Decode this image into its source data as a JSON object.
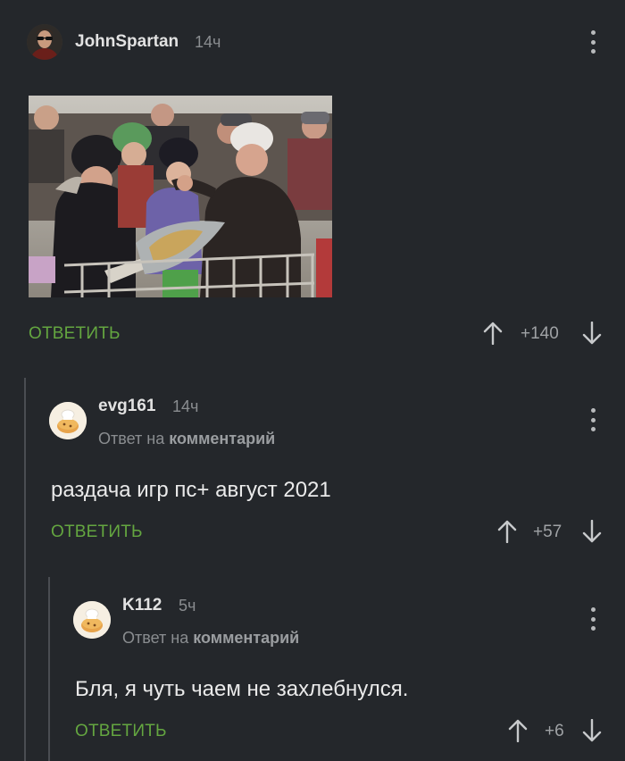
{
  "post": {
    "author": "JohnSpartan",
    "time": "14ч",
    "rating": "+140",
    "reply_label": "ОТВЕТИТЬ"
  },
  "comments": [
    {
      "author": "evg161",
      "time": "14ч",
      "reply_prefix": "Ответ на",
      "reply_target": "комментарий",
      "text": "раздача игр пс+ август 2021",
      "reply_label": "ОТВЕТИТЬ",
      "rating": "+57"
    },
    {
      "author": "K112",
      "time": "5ч",
      "reply_prefix": "Ответ на",
      "reply_target": "комментарий",
      "text": "Бля, я чуть чаем не захлебнулся.",
      "reply_label": "ОТВЕТИТЬ",
      "rating": "+6"
    }
  ],
  "colors": {
    "background": "#24272b",
    "accent_reply": "#64a640",
    "thread_line": "#4a4d52",
    "muted_text": "#8a8d90"
  },
  "icons": [
    "kebab-menu-icon",
    "arrow-up-icon",
    "arrow-down-icon",
    "cookie-avatar-icon"
  ]
}
